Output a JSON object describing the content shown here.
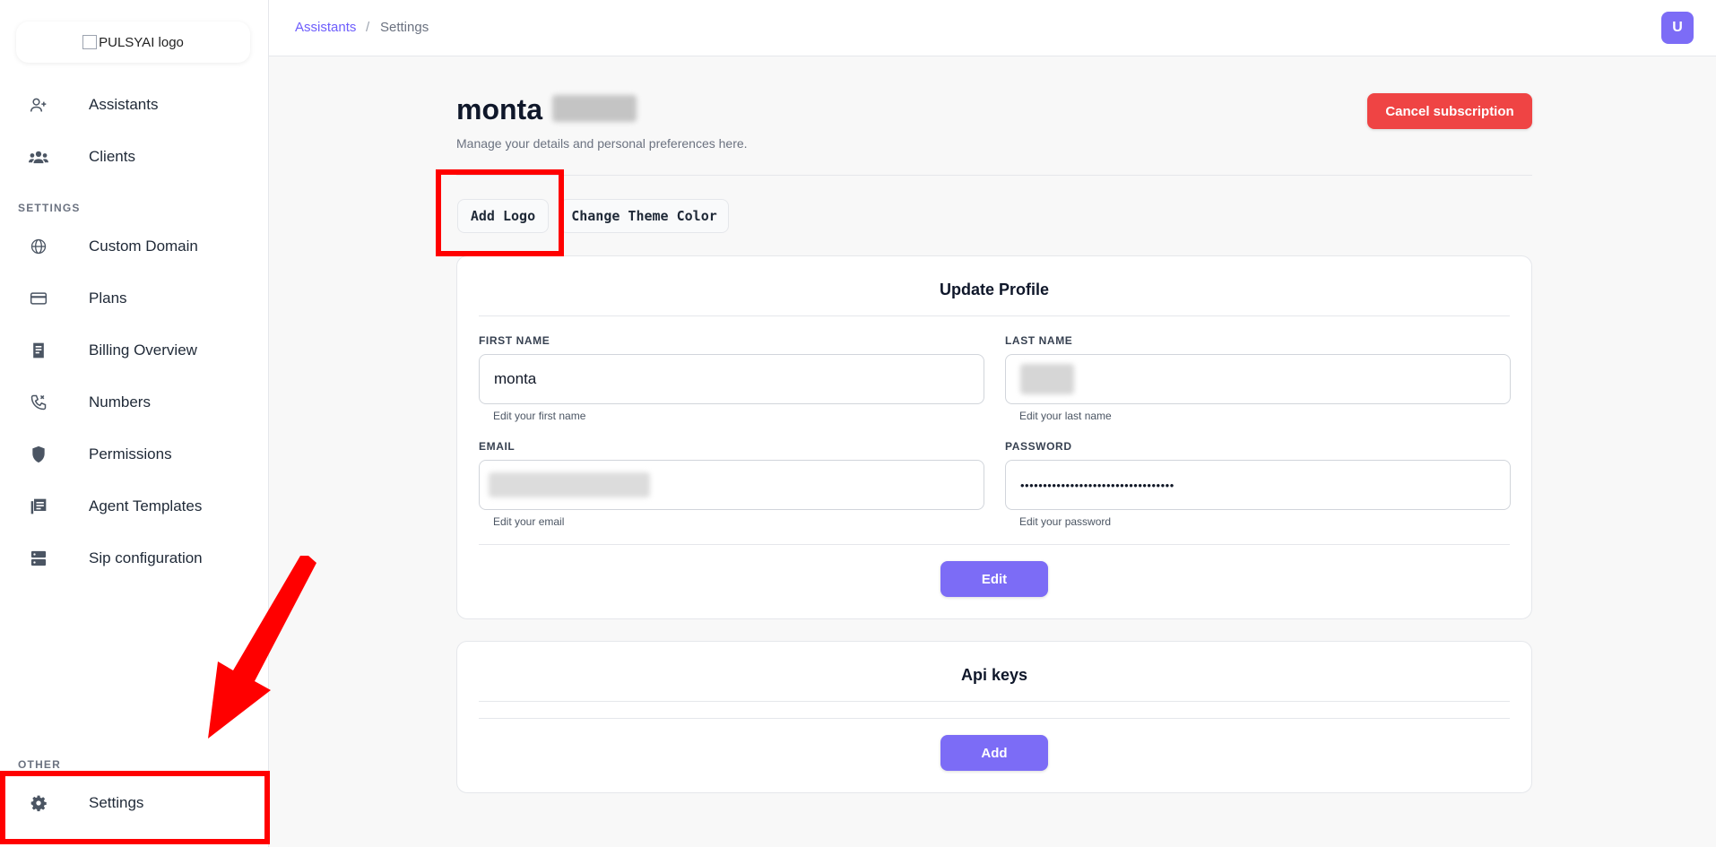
{
  "sidebar": {
    "logo_alt": "PULSYAI logo",
    "items_main": [
      {
        "label": "Assistants",
        "icon": "user-plus-icon"
      },
      {
        "label": "Clients",
        "icon": "users-icon"
      }
    ],
    "settings_section_label": "SETTINGS",
    "items_settings": [
      {
        "label": "Custom Domain",
        "icon": "globe-icon"
      },
      {
        "label": "Plans",
        "icon": "credit-card-icon"
      },
      {
        "label": "Billing Overview",
        "icon": "receipt-icon"
      },
      {
        "label": "Numbers",
        "icon": "phone-icon"
      },
      {
        "label": "Permissions",
        "icon": "shield-icon"
      },
      {
        "label": "Agent Templates",
        "icon": "library-icon"
      },
      {
        "label": "Sip configuration",
        "icon": "server-icon"
      }
    ],
    "other_section_label": "OTHER",
    "items_other": [
      {
        "label": "Settings",
        "icon": "gear-icon"
      }
    ]
  },
  "topbar": {
    "breadcrumb_link": "Assistants",
    "breadcrumb_separator": "/",
    "breadcrumb_current": "Settings",
    "avatar_initial": "U"
  },
  "header": {
    "name": "monta",
    "subtitle": "Manage your details and personal preferences here.",
    "cancel_label": "Cancel subscription"
  },
  "tabs": {
    "add_logo": "Add Logo",
    "change_theme": "Change Theme Color"
  },
  "profile": {
    "title": "Update Profile",
    "first_name_label": "FIRST NAME",
    "first_name_value": "monta",
    "first_name_help": "Edit your first name",
    "last_name_label": "LAST NAME",
    "last_name_help": "Edit your last name",
    "email_label": "EMAIL",
    "email_help": "Edit your email",
    "password_label": "PASSWORD",
    "password_value": "••••••••••••••••••••••••••••••••••",
    "password_help": "Edit your password",
    "edit_label": "Edit"
  },
  "api_keys": {
    "title": "Api keys",
    "add_label": "Add"
  },
  "colors": {
    "accent": "#7c6cf6",
    "danger": "#ef4444",
    "annotation": "#ff0000"
  }
}
